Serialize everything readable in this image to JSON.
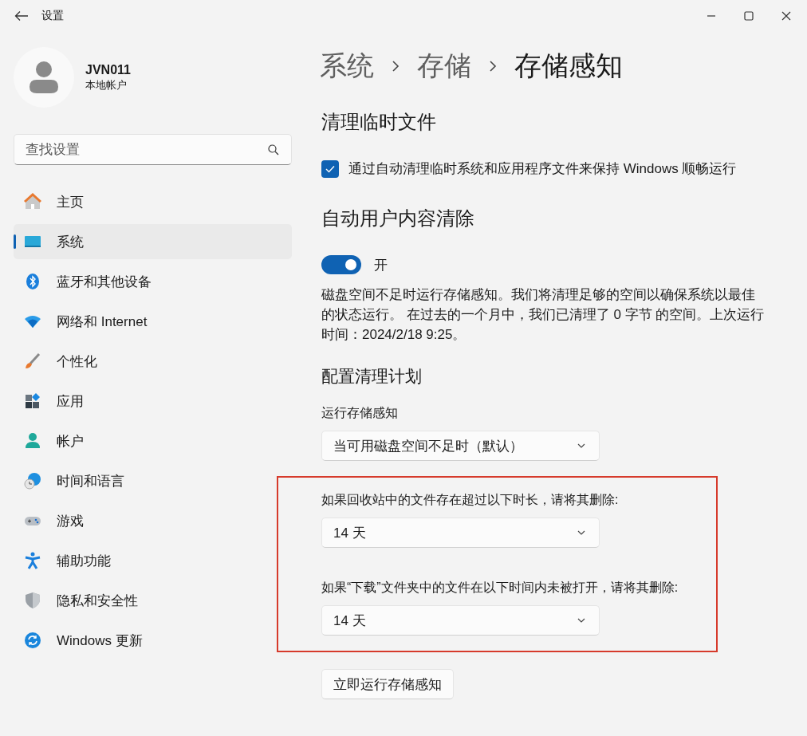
{
  "window": {
    "title": "设置"
  },
  "account": {
    "name": "JVN011",
    "type": "本地帐户"
  },
  "search": {
    "placeholder": "查找设置"
  },
  "nav": [
    {
      "label": "主页",
      "selected": false
    },
    {
      "label": "系统",
      "selected": true
    },
    {
      "label": "蓝牙和其他设备",
      "selected": false
    },
    {
      "label": "网络和 Internet",
      "selected": false
    },
    {
      "label": "个性化",
      "selected": false
    },
    {
      "label": "应用",
      "selected": false
    },
    {
      "label": "帐户",
      "selected": false
    },
    {
      "label": "时间和语言",
      "selected": false
    },
    {
      "label": "游戏",
      "selected": false
    },
    {
      "label": "辅助功能",
      "selected": false
    },
    {
      "label": "隐私和安全性",
      "selected": false
    },
    {
      "label": "Windows 更新",
      "selected": false
    }
  ],
  "breadcrumb": [
    "系统",
    "存储",
    "存储感知"
  ],
  "temp_files": {
    "heading": "清理临时文件",
    "checkbox": {
      "label": "通过自动清理临时系统和应用程序文件来保持 Windows 顺畅运行",
      "checked": true
    }
  },
  "auto_cleanup": {
    "heading": "自动用户内容清除",
    "toggle": {
      "on": true,
      "label": "开"
    },
    "description": "磁盘空间不足时运行存储感知。我们将清理足够的空间以确保系统以最佳的状态运行。 在过去的一个月中，我们已清理了 0 字节 的空间。上次运行时间：2024/2/18 9:25。"
  },
  "schedule": {
    "heading": "配置清理计划",
    "run": {
      "label": "运行存储感知",
      "value": "当可用磁盘空间不足时（默认）"
    },
    "highlighted": true,
    "rules": [
      {
        "label": "如果回收站中的文件存在超过以下时长，请将其删除:",
        "value": "14 天"
      },
      {
        "label": "如果“下载”文件夹中的文件在以下时间内未被打开，请将其删除:",
        "value": "14 天"
      }
    ],
    "run_now_button": "立即运行存储感知"
  }
}
